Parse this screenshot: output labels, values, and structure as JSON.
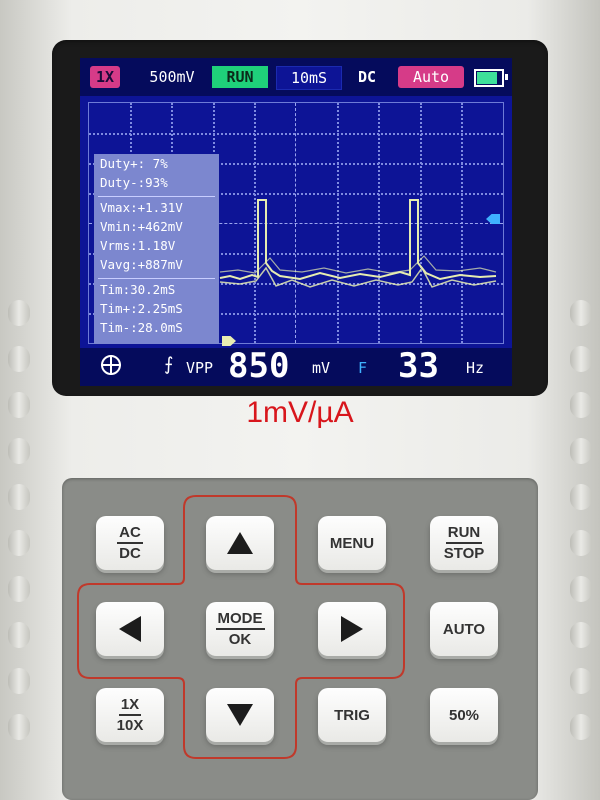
{
  "topbar": {
    "probe": "1X",
    "volts_div": "500mV",
    "run_state": "RUN",
    "time_div": "10mS",
    "coupling": "DC",
    "trigger_mode": "Auto",
    "battery_icon": "battery-icon"
  },
  "measurements": {
    "duty_pos": "Duty+: 7%",
    "duty_neg": "Duty-:93%",
    "vmax": "Vmax:+1.31V",
    "vmin": "Vmin:+462mV",
    "vrms": "Vrms:1.18V",
    "vavg": "Vavg:+887mV",
    "tim": "Tim:30.2mS",
    "tim_pos": "Tim+:2.25mS",
    "tim_neg": "Tim-:28.0mS"
  },
  "bottombar": {
    "move_icon": "crosshair-move-icon",
    "edge_icon": "rising-edge-icon",
    "vpp_label": "VPP",
    "vpp_value": "850",
    "vpp_unit": "mV",
    "freq_label": "F",
    "freq_value": "33",
    "freq_unit": "Hz"
  },
  "caption": "1mV/µA",
  "keys": {
    "ac_dc": {
      "top": "AC",
      "bottom": "DC"
    },
    "up": "up-arrow-icon",
    "menu": "MENU",
    "run_stop": {
      "top": "RUN",
      "bottom": "STOP"
    },
    "left": "left-arrow-icon",
    "mode_ok": {
      "top": "MODE",
      "bottom": "OK"
    },
    "right": "right-arrow-icon",
    "auto": "AUTO",
    "probe_1x_10x": {
      "top": "1X",
      "bottom": "10X"
    },
    "down": "down-arrow-icon",
    "trig": "TRIG",
    "pct50": "50%"
  },
  "colors": {
    "screen_bg": "#0d1496",
    "trace": "#e6ecb0",
    "caption": "#d8161c",
    "key_outline": "#c0392b"
  }
}
